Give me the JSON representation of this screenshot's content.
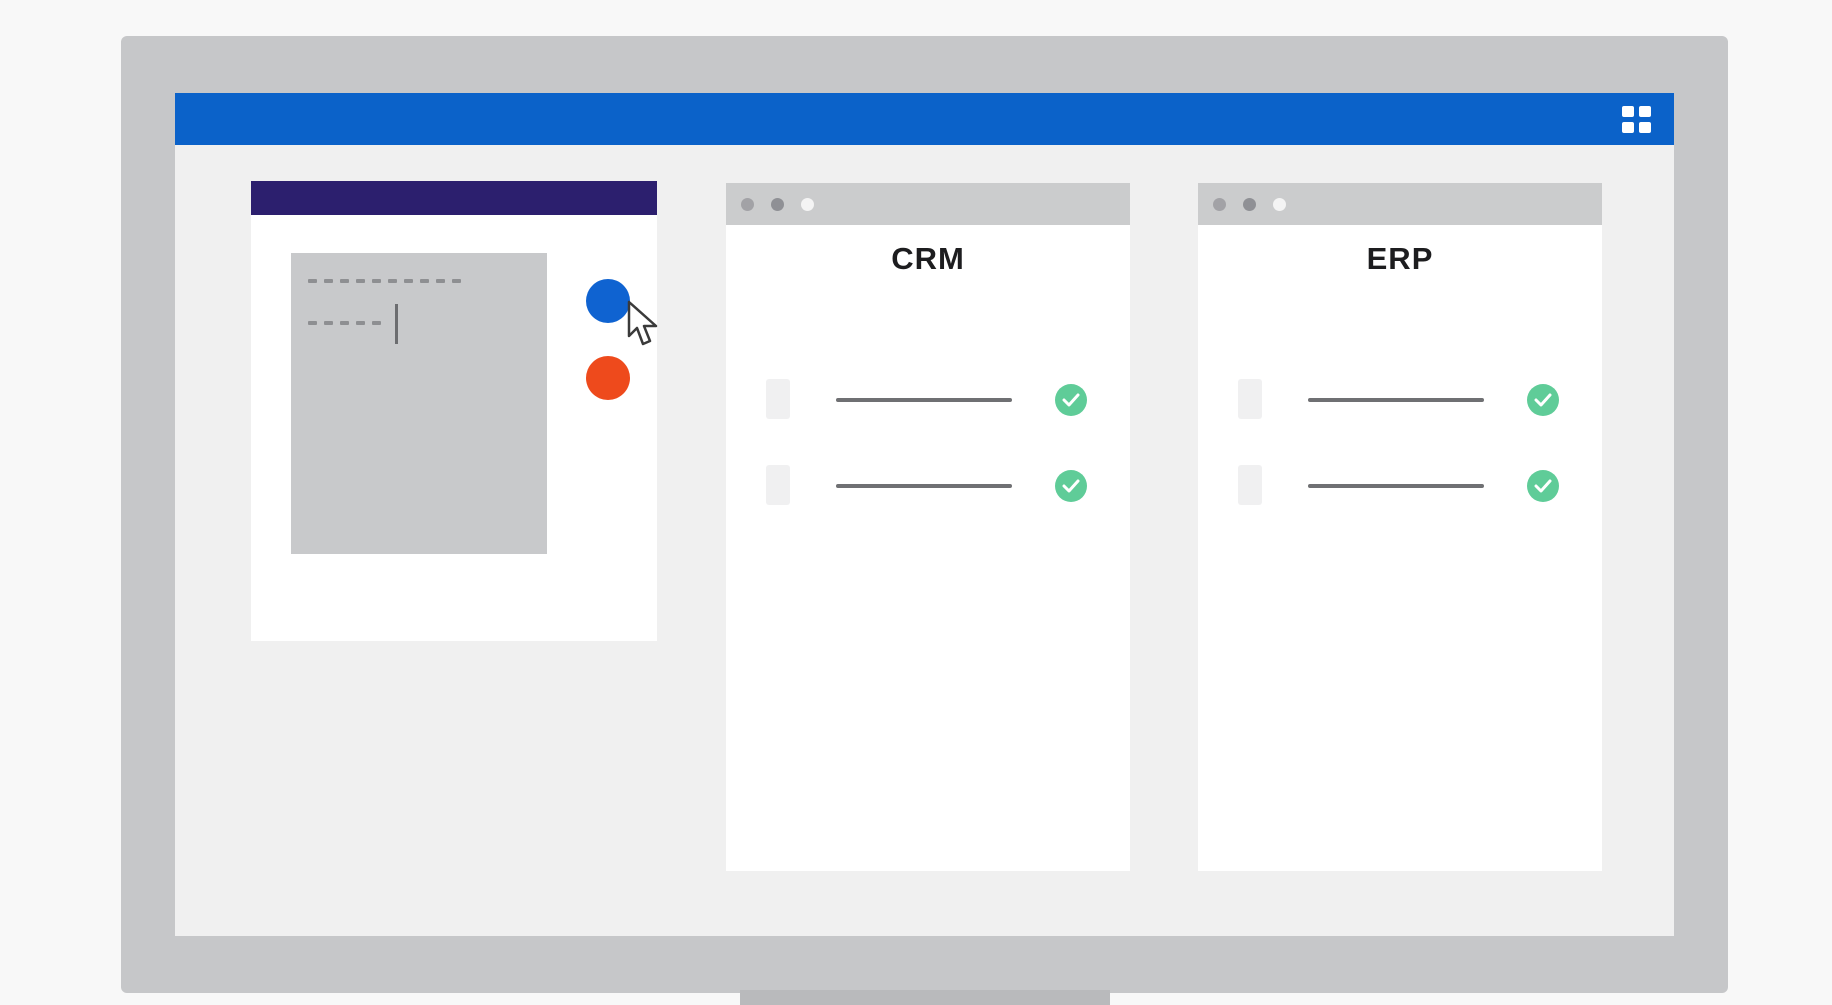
{
  "app_bar": {
    "icon": "grid-icon",
    "color": "#0b62c9"
  },
  "source_widget": {
    "header_color": "#2c1f6e",
    "text_area_icon": "placeholder-text-dashes",
    "actions": [
      {
        "name": "blue-action-dot",
        "color": "#0f63d1"
      },
      {
        "name": "orange-action-dot",
        "color": "#ee4a1c"
      }
    ],
    "cursor_icon": "pointer-icon"
  },
  "windows": [
    {
      "title": "CRM",
      "rows": [
        {
          "icon": "document-icon",
          "status_icon": "check-icon"
        },
        {
          "icon": "document-icon",
          "status_icon": "check-icon"
        }
      ]
    },
    {
      "title": "ERP",
      "rows": [
        {
          "icon": "document-icon",
          "status_icon": "check-icon"
        },
        {
          "icon": "document-icon",
          "status_icon": "check-icon"
        }
      ]
    }
  ],
  "colors": {
    "check": "#5fcc98",
    "bezel": "#c6c7c9",
    "screen": "#f0f0f0"
  }
}
